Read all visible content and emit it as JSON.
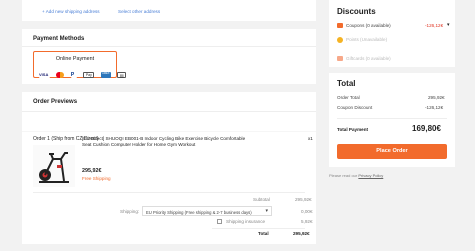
{
  "address": {
    "add_link": "+ Add new shipping address",
    "select_link": "Select other address"
  },
  "payment": {
    "heading": "Payment Methods",
    "option_label": "Online Payment",
    "icons": [
      "visa",
      "mastercard",
      "paypal",
      "applepay",
      "amex",
      "bank"
    ],
    "icon_texts": [
      "VISA",
      "",
      "P",
      "Pay",
      "AMEX",
      "▤"
    ]
  },
  "orders": {
    "heading": "Order Previews",
    "order_label": "Order 1 (Ship from CZ Direct)",
    "product": {
      "title": "[EU Direct] SHUOQI EB001-B Indoor Cycling Bike Exercise Bicycle Comfortable Seat Cushion Computer Holder for Home Gym Workout",
      "qty": "x1",
      "price": "295,92€",
      "shipping_note": "Free Shipping"
    },
    "subtotal_label": "Subtotal",
    "subtotal_value": "295,92€",
    "shipping_label": "Shipping:",
    "shipping_option": "EU Priority Shipping (Free shipping & 2-7 business days)",
    "shipping_value": "0,00€",
    "insurance_label": "Shipping insurance",
    "insurance_value": "5,92€",
    "total_label": "Total",
    "total_value": "295,92€"
  },
  "discounts": {
    "heading": "Discounts",
    "coupons_label": "Coupons (0 available)",
    "coupons_value": "-126,12€",
    "points_label": "Points (Unavailable)",
    "giftcard_label": "Giftcards (0 available)"
  },
  "total": {
    "heading": "Total",
    "order_total_label": "Order Total",
    "order_total_value": "295,92€",
    "coupon_label": "Coupon Discount",
    "coupon_value": "-126,12€",
    "payment_label": "Total Payment",
    "payment_value": "169,80€",
    "place_order": "Place Order"
  },
  "policy": {
    "prefix": "Please read our ",
    "link": "Privacy Policy"
  },
  "colors": {
    "accent": "#f26b2c",
    "link": "#4a7fd6"
  }
}
